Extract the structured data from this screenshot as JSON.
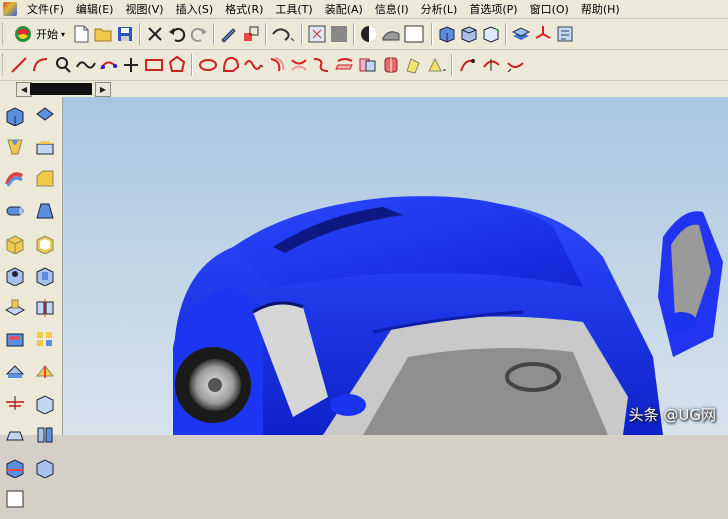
{
  "menubar": {
    "items": [
      "文件(F)",
      "编辑(E)",
      "视图(V)",
      "插入(S)",
      "格式(R)",
      "工具(T)",
      "装配(A)",
      "信息(I)",
      "分析(L)",
      "首选项(P)",
      "窗口(O)",
      "帮助(H)"
    ]
  },
  "toolbar": {
    "start_label": "开始",
    "colors": {
      "accent_blue": "#1a3fe0",
      "toolbar_bg": "#ece9d8"
    }
  },
  "watermark": {
    "text": "头条 @UG网"
  },
  "viewport": {
    "model_color": "#1630e8",
    "background": "#b9cfe3"
  }
}
